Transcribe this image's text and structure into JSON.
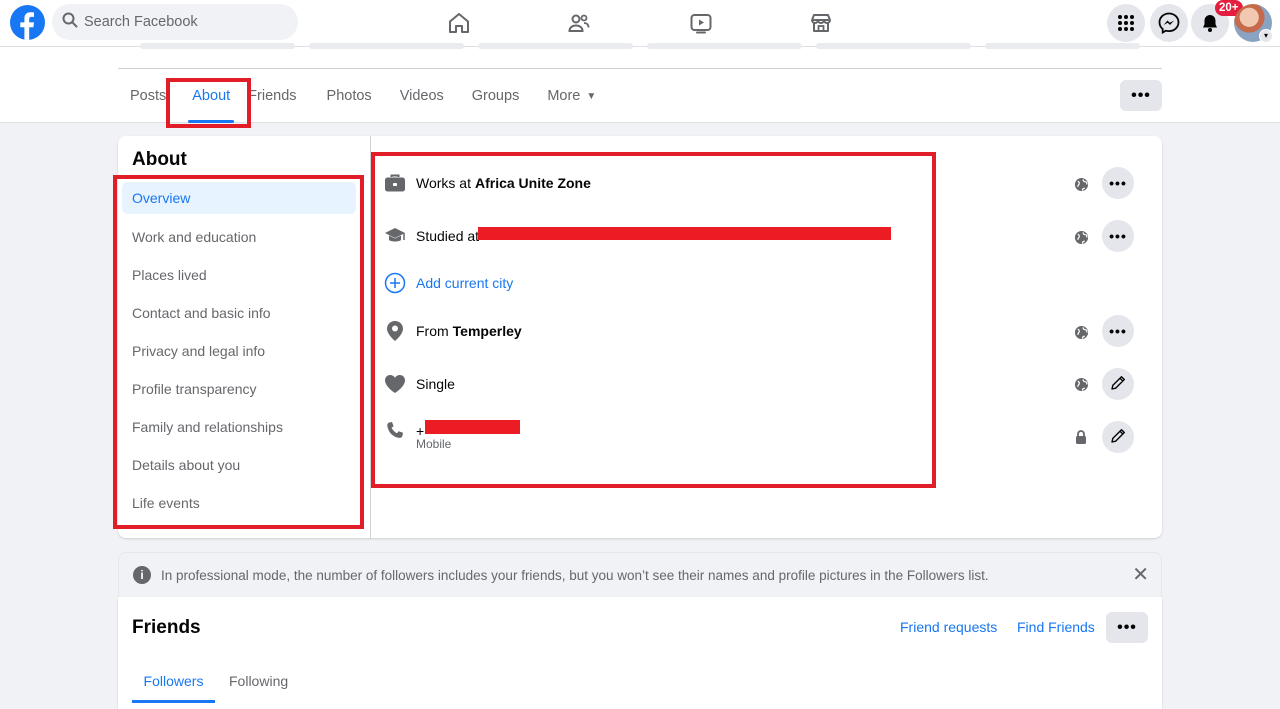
{
  "topbar": {
    "search_placeholder": "Search Facebook",
    "notification_count": "20+",
    "nav_icons": [
      "home-icon",
      "friends-icon",
      "watch-icon",
      "marketplace-icon"
    ],
    "right_icons": [
      "menu-grid-icon",
      "messenger-icon",
      "bell-icon"
    ]
  },
  "profile_tabs": {
    "items": [
      "Posts",
      "About",
      "Friends",
      "Photos",
      "Videos",
      "Groups",
      "More"
    ],
    "active": "About",
    "more_options": "•••"
  },
  "about": {
    "title": "About",
    "nav": [
      "Overview",
      "Work and education",
      "Places lived",
      "Contact and basic info",
      "Privacy and legal info",
      "Profile transparency",
      "Family and relationships",
      "Details about you",
      "Life events"
    ],
    "active_nav": "Overview",
    "rows": {
      "work_prefix": "Works at",
      "work_value": "Africa Unite Zone",
      "study_prefix": "Studied at",
      "add_city": "Add current city",
      "from_prefix": "From",
      "from_value": "Temperley",
      "relationship": "Single",
      "phone_prefix": "+",
      "phone_label": "Mobile"
    },
    "row_action": "•••"
  },
  "notice": {
    "text": "In professional mode, the number of followers includes your friends, but you won’t see their names and profile pictures in the Followers list."
  },
  "friends": {
    "title": "Friends",
    "friend_requests": "Friend requests",
    "find_friends": "Find Friends",
    "more": "•••",
    "tabs": [
      "Followers",
      "Following"
    ]
  },
  "colors": {
    "brand": "#1877f2",
    "highlight": "#e11d27",
    "redaction": "#ec1c24"
  }
}
